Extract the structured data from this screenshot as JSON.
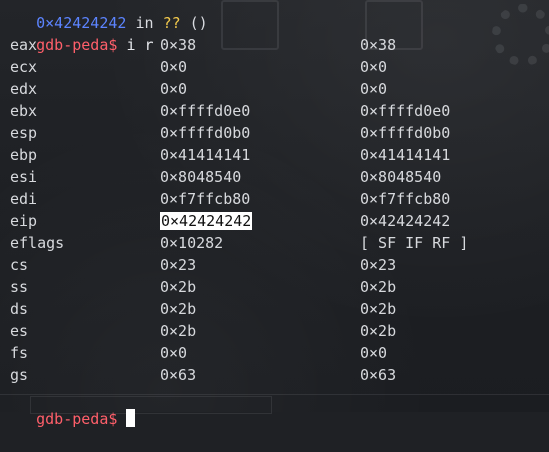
{
  "top_partial": {
    "addr": "0×42424242",
    "in": "in",
    "q": "??",
    "paren": "()"
  },
  "prompt_label": "gdb-peda$",
  "command": "i r",
  "registers": [
    {
      "name": "eax",
      "hex": "0×38",
      "natural": "0×38"
    },
    {
      "name": "ecx",
      "hex": "0×0",
      "natural": "0×0"
    },
    {
      "name": "edx",
      "hex": "0×0",
      "natural": "0×0"
    },
    {
      "name": "ebx",
      "hex": "0×ffffd0e0",
      "natural": "0×ffffd0e0"
    },
    {
      "name": "esp",
      "hex": "0×ffffd0b0",
      "natural": "0×ffffd0b0"
    },
    {
      "name": "ebp",
      "hex": "0×41414141",
      "natural": "0×41414141"
    },
    {
      "name": "esi",
      "hex": "0×8048540",
      "natural": "0×8048540"
    },
    {
      "name": "edi",
      "hex": "0×f7ffcb80",
      "natural": "0×f7ffcb80"
    },
    {
      "name": "eip",
      "hex": "0×42424242",
      "natural": "0×42424242"
    },
    {
      "name": "eflags",
      "hex": "0×10282",
      "natural": "[ SF IF RF ]"
    },
    {
      "name": "cs",
      "hex": "0×23",
      "natural": "0×23"
    },
    {
      "name": "ss",
      "hex": "0×2b",
      "natural": "0×2b"
    },
    {
      "name": "ds",
      "hex": "0×2b",
      "natural": "0×2b"
    },
    {
      "name": "es",
      "hex": "0×2b",
      "natural": "0×2b"
    },
    {
      "name": "fs",
      "hex": "0×0",
      "natural": "0×0"
    },
    {
      "name": "gs",
      "hex": "0×63",
      "natural": "0×63"
    }
  ],
  "colors": {
    "background": "#1f2125",
    "prompt": "#ff5f6a",
    "text": "#d7d9dd",
    "address_blue": "#5c84ff",
    "question_yellow": "#f2c94c",
    "highlight_bg": "#ffffff"
  },
  "icons": {
    "cursor": "block-cursor",
    "background_files": "file-icon",
    "background_gear": "gear-icon"
  }
}
